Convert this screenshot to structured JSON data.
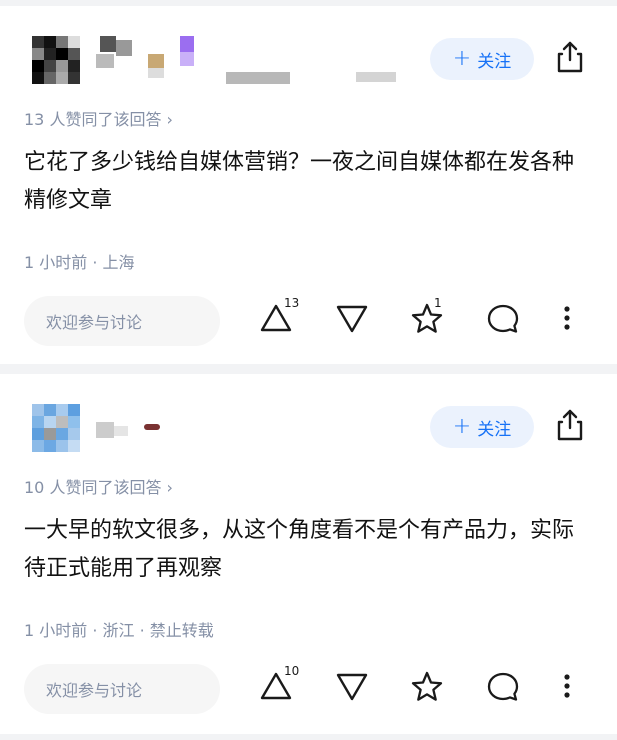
{
  "answers": [
    {
      "follow_label": "关注",
      "agree_text": "13 人赞同了该回答 ›",
      "content": "它花了多少钱给自媒体营销？一夜之间自媒体都在发各种精修文章",
      "meta": "1 小时前 · 上海",
      "comment_placeholder": "欢迎参与讨论",
      "upvote_count": "13",
      "favorite_count": "1"
    },
    {
      "follow_label": "关注",
      "agree_text": "10 人赞同了该回答 ›",
      "content": "一大早的软文很多，从这个角度看不是个有产品力，实际待正式能用了再观察",
      "meta": "1 小时前 · 浙江 · 禁止转载",
      "comment_placeholder": "欢迎参与讨论",
      "upvote_count": "10",
      "favorite_count": ""
    }
  ],
  "icons": [
    "plus-icon",
    "share-icon",
    "upvote-icon",
    "downvote-icon",
    "star-icon",
    "comment-icon",
    "more-icon"
  ],
  "colors": {
    "accent": "#1772f6",
    "follow_bg": "#ebf2fd",
    "muted": "#8590a6"
  }
}
